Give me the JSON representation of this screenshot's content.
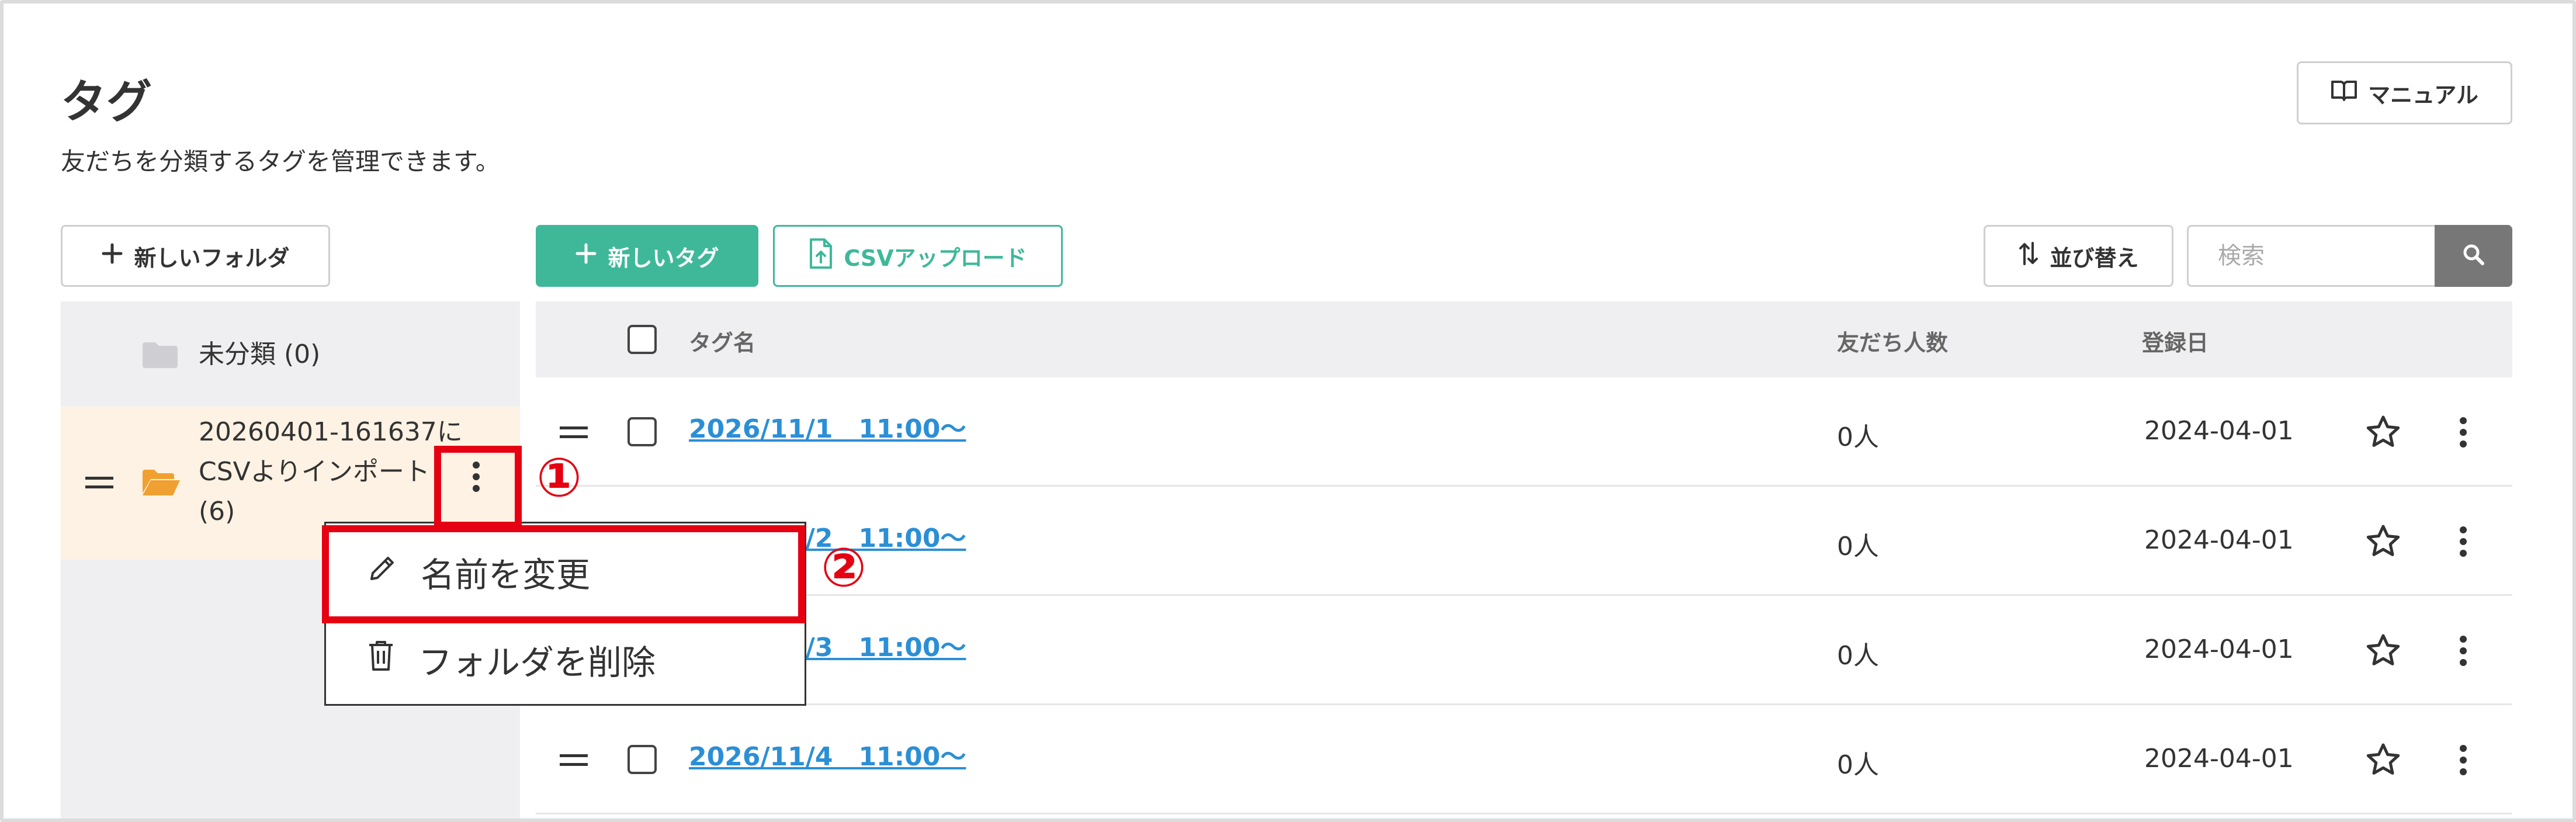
{
  "header": {
    "title": "タグ",
    "subtitle": "友だちを分類するタグを管理できます。",
    "manual_label": "マニュアル"
  },
  "toolbar": {
    "new_folder_label": "新しいフォルダ",
    "new_tag_label": "新しいタグ",
    "csv_upload_label": "CSVアップロード",
    "sort_label": "並び替え",
    "search_placeholder": "検索"
  },
  "sidebar": {
    "folders": [
      {
        "label": "未分類 (0)"
      },
      {
        "label_lines": [
          "20260401-161637に",
          "CSVよりインポート",
          "(6)"
        ]
      }
    ]
  },
  "context_menu": {
    "rename_label": "名前を変更",
    "delete_label": "フォルダを削除"
  },
  "annotations": {
    "step1": "①",
    "step2": "②"
  },
  "table": {
    "columns": {
      "name": "タグ名",
      "friends": "友だち人数",
      "registered": "登録日"
    },
    "rows": [
      {
        "name": "2026/11/1　11:00〜",
        "friends": "0人",
        "date": "2024-04-01"
      },
      {
        "name": "2026/11/2　11:00〜",
        "friends": "0人",
        "date": "2024-04-01"
      },
      {
        "name": "2026/11/3　11:00〜",
        "friends": "0人",
        "date": "2024-04-01"
      },
      {
        "name": "2026/11/4　11:00〜",
        "friends": "0人",
        "date": "2024-04-01"
      }
    ]
  },
  "colors": {
    "accent_green": "#3fb89a",
    "link_blue": "#2b8fd6",
    "active_folder_bg": "#fdf2e3",
    "folder_orange": "#f0a030",
    "annotation_red": "#e50012"
  }
}
